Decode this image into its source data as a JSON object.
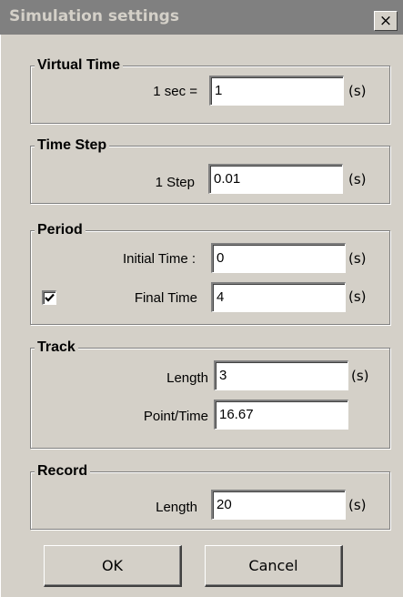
{
  "window": {
    "title": "Simulation settings",
    "close_glyph": "×"
  },
  "virtual_time": {
    "legend": "Virtual Time",
    "label": "1 sec =",
    "value": "1",
    "unit": "(s)"
  },
  "time_step": {
    "legend": "Time Step",
    "label": "1 Step",
    "value": "0.01",
    "unit": "(s)"
  },
  "period": {
    "legend": "Period",
    "initial_label": "Initial Time :",
    "initial_value": "0",
    "initial_unit": "(s)",
    "final_checked": true,
    "final_label": "Final Time",
    "final_value": "4",
    "final_unit": "(s)"
  },
  "track": {
    "legend": "Track",
    "length_label": "Length",
    "length_value": "3",
    "length_unit": "(s)",
    "point_label": "Point/Time",
    "point_value": "16.67"
  },
  "record": {
    "legend": "Record",
    "length_label": "Length",
    "length_value": "20",
    "length_unit": "(s)"
  },
  "buttons": {
    "ok": "OK",
    "cancel": "Cancel"
  },
  "icons": {
    "close": "close-icon",
    "checkmark": "checkmark-icon"
  }
}
